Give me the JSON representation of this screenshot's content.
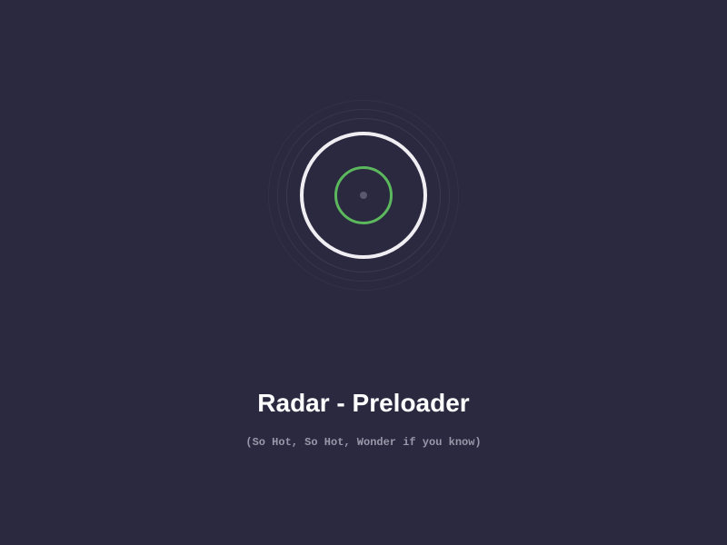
{
  "title": "Radar - Preloader",
  "subtitle": "(So Hot, So Hot, Wonder if you know)"
}
